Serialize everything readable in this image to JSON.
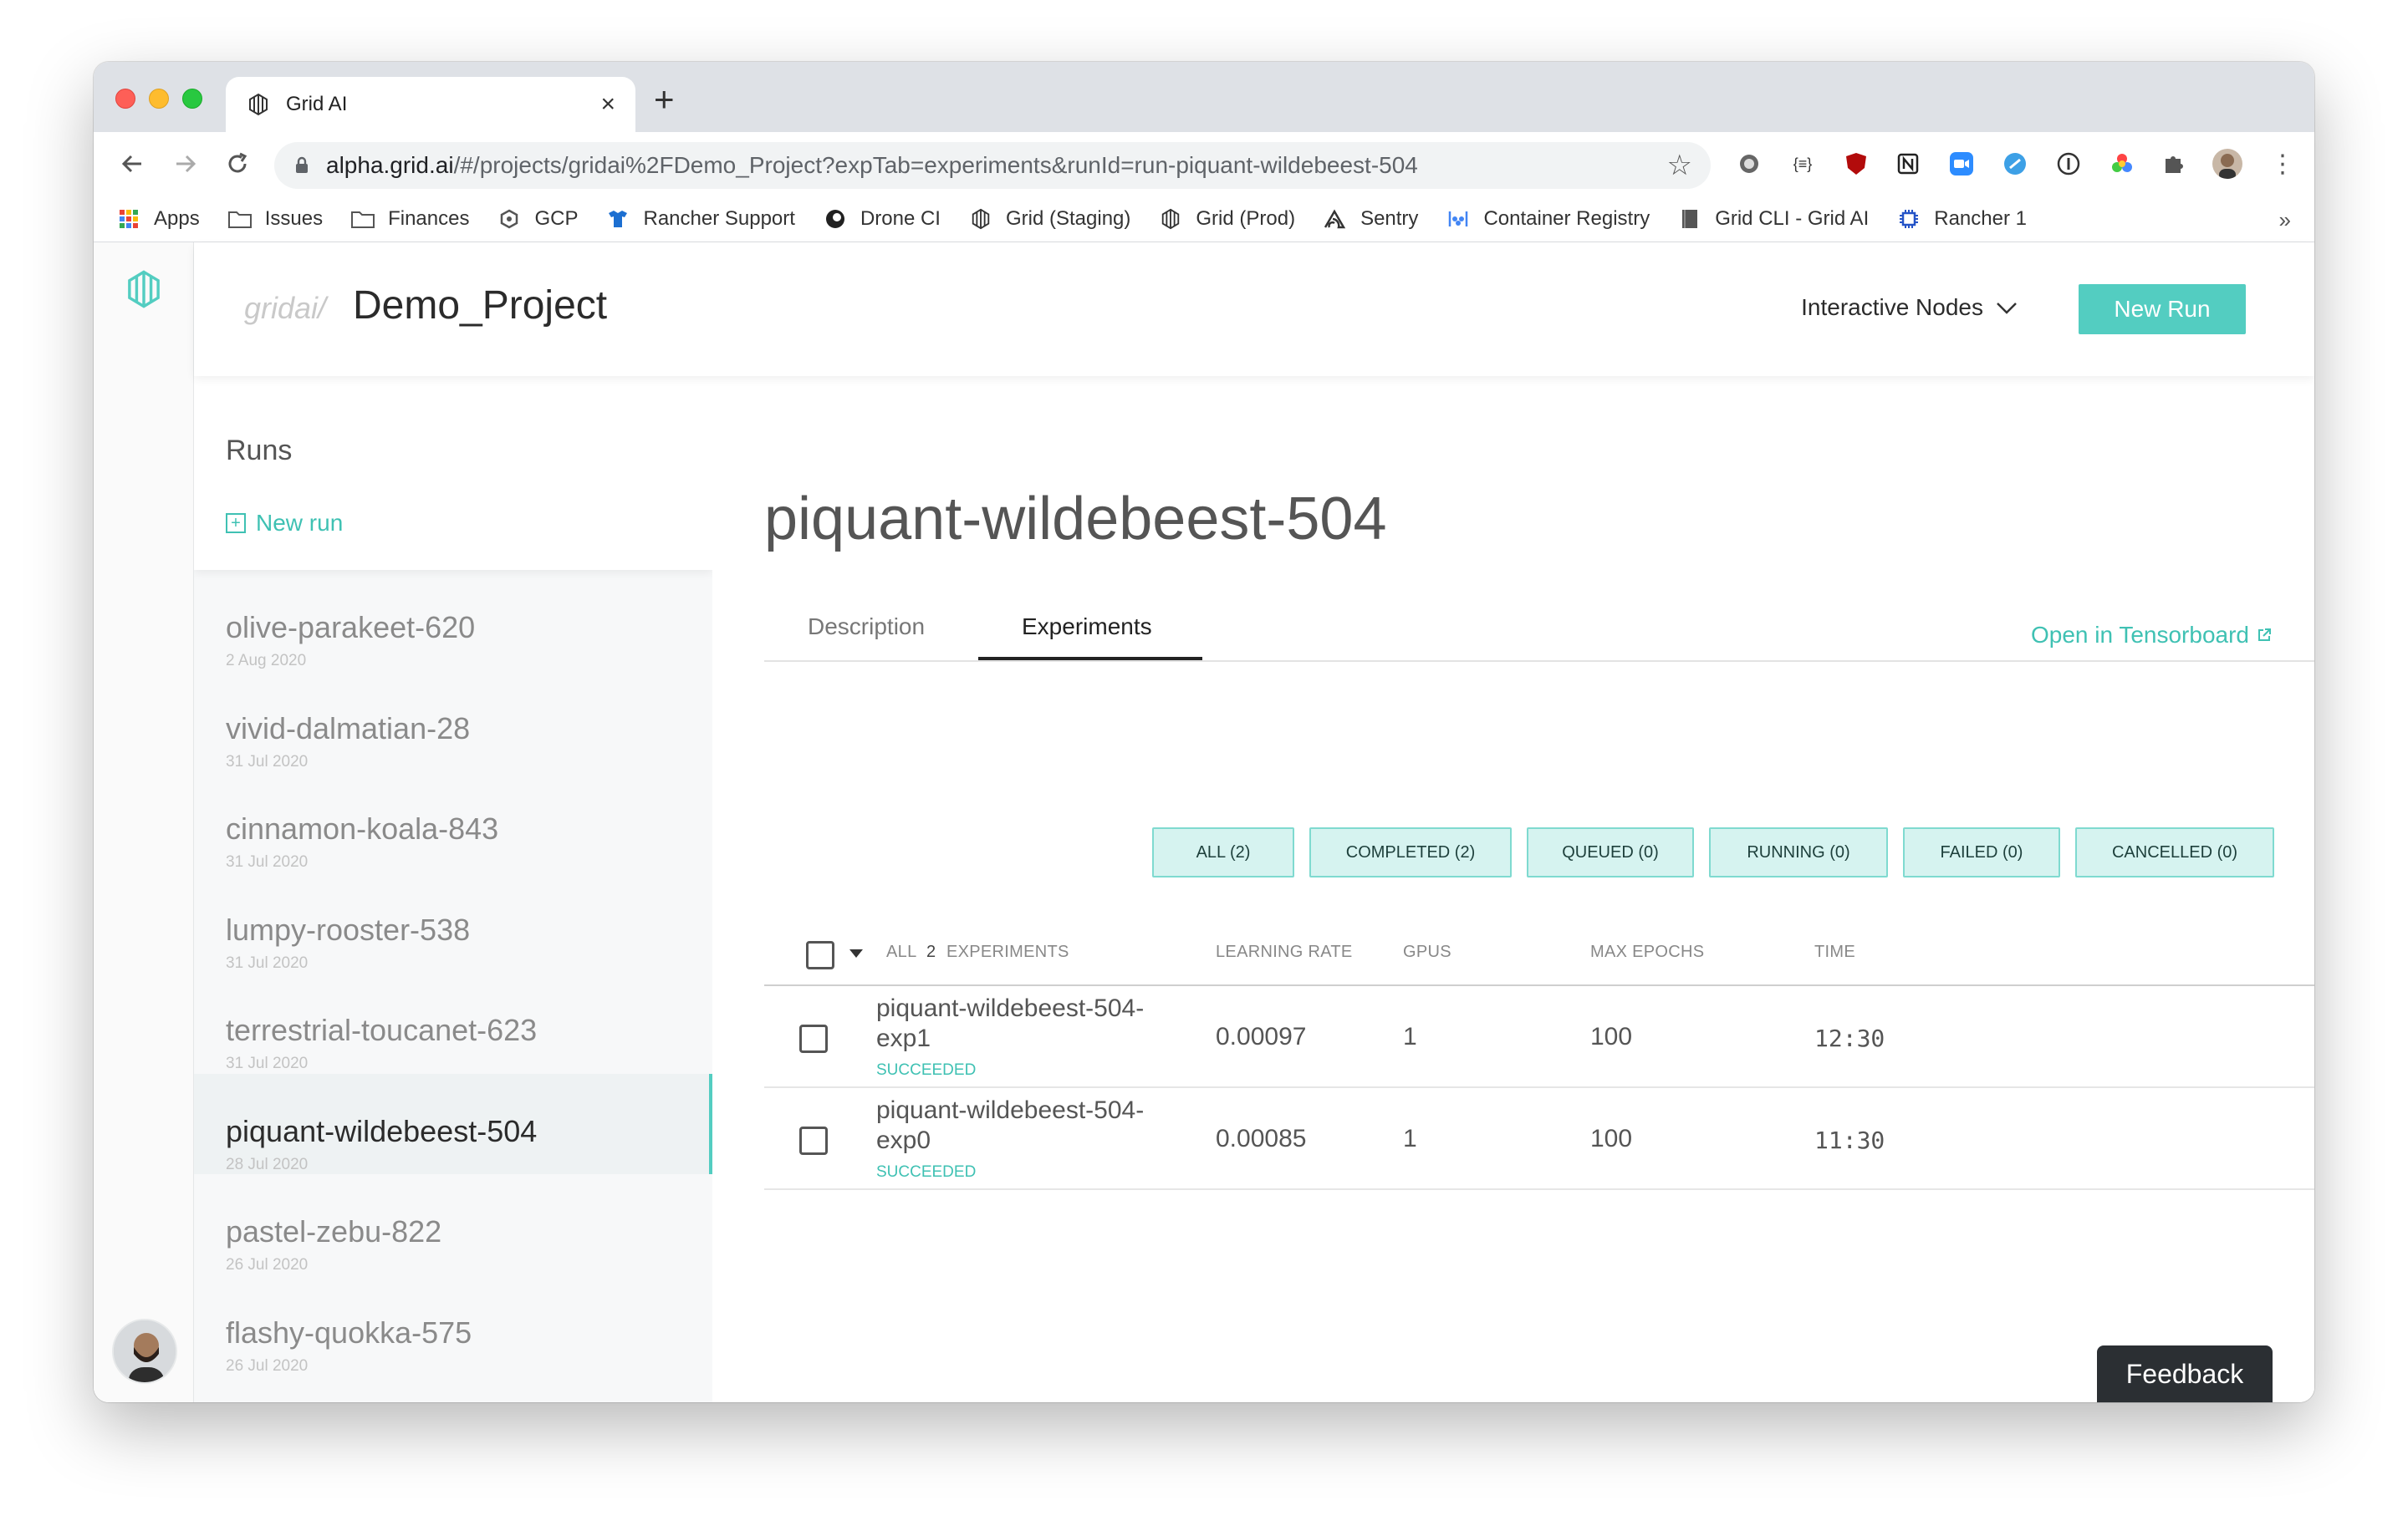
{
  "browser": {
    "tab_title": "Grid AI",
    "tab_close": "×",
    "new_tab": "+",
    "url_domain": "alpha.grid.ai",
    "url_rest": "/#/projects/gridai%2FDemo_Project?expTab=experiments&runId=run-piquant-wildebeest-504",
    "bookmarks": [
      {
        "label": "Apps",
        "icon": "apps-grid-icon"
      },
      {
        "label": "Issues",
        "icon": "folder-icon"
      },
      {
        "label": "Finances",
        "icon": "folder-icon"
      },
      {
        "label": "GCP",
        "icon": "gcp-icon"
      },
      {
        "label": "Rancher Support",
        "icon": "rancher-icon"
      },
      {
        "label": "Drone CI",
        "icon": "drone-icon"
      },
      {
        "label": "Grid (Staging)",
        "icon": "grid-icon"
      },
      {
        "label": "Grid (Prod)",
        "icon": "grid-icon"
      },
      {
        "label": "Sentry",
        "icon": "sentry-icon"
      },
      {
        "label": "Container Registry",
        "icon": "registry-icon"
      },
      {
        "label": "Grid CLI - Grid AI",
        "icon": "book-icon"
      },
      {
        "label": "Rancher 1",
        "icon": "chip-icon"
      }
    ],
    "bookmarks_more": "»"
  },
  "header": {
    "org": "gridai/",
    "project": "Demo_Project",
    "nodes_dropdown": "Interactive Nodes",
    "new_run_button": "New Run"
  },
  "runs_panel": {
    "title": "Runs",
    "new_run_link": "New run",
    "runs": [
      {
        "name": "olive-parakeet-620",
        "date": "2 Aug 2020"
      },
      {
        "name": "vivid-dalmatian-28",
        "date": "31 Jul 2020"
      },
      {
        "name": "cinnamon-koala-843",
        "date": "31 Jul 2020"
      },
      {
        "name": "lumpy-rooster-538",
        "date": "31 Jul 2020"
      },
      {
        "name": "terrestrial-toucanet-623",
        "date": "31 Jul 2020"
      },
      {
        "name": "piquant-wildebeest-504",
        "date": "28 Jul 2020"
      },
      {
        "name": "pastel-zebu-822",
        "date": "26 Jul 2020"
      },
      {
        "name": "flashy-quokka-575",
        "date": "26 Jul 2020"
      }
    ],
    "active_index": 5
  },
  "main": {
    "run_title": "piquant-wildebeest-504",
    "tabs": [
      "Description",
      "Experiments"
    ],
    "active_tab": "Experiments",
    "tensorboard_link": "Open in Tensorboard",
    "filters": [
      "ALL (2)",
      "COMPLETED (2)",
      "QUEUED (0)",
      "RUNNING (0)",
      "FAILED (0)",
      "CANCELLED (0)"
    ],
    "table": {
      "select_all_label": "ALL",
      "experiment_count": "2",
      "experiments_label": "EXPERIMENTS",
      "columns": [
        "LEARNING RATE",
        "GPUS",
        "MAX EPOCHS",
        "TIME"
      ],
      "rows": [
        {
          "name_line1": "piquant-wildebeest-504-",
          "name_line2": "exp1",
          "status": "SUCCEEDED",
          "learning_rate": "0.00097",
          "gpus": "1",
          "max_epochs": "100",
          "time": "12:30"
        },
        {
          "name_line1": "piquant-wildebeest-504-",
          "name_line2": "exp0",
          "status": "SUCCEEDED",
          "learning_rate": "0.00085",
          "gpus": "1",
          "max_epochs": "100",
          "time": "11:30"
        }
      ]
    }
  },
  "feedback_button": "Feedback",
  "colors": {
    "accent": "#53cdc1",
    "accent_text": "#3fc1b3",
    "filter_bg": "#d6f3f0"
  }
}
